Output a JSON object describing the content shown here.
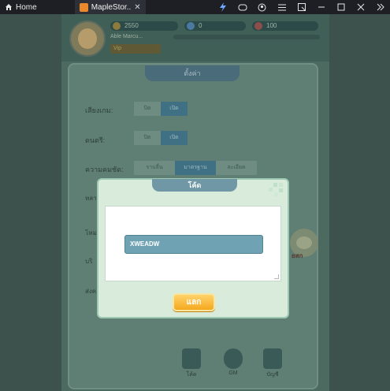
{
  "titlebar": {
    "home_label": "Home",
    "tab_label": "MapleStor...",
    "tab_close": "✕",
    "window_icons": [
      "bolt-icon",
      "gamepad-icon",
      "account-icon",
      "menu-icon",
      "external-icon",
      "minimize-icon",
      "maximize-icon",
      "close-icon",
      "double-chevron-icon"
    ]
  },
  "hud": {
    "gold": "2550",
    "gems": "0",
    "hearts": "100",
    "player_name": "Able Marcu...",
    "vip": "Vip"
  },
  "settings": {
    "title": "ตั้งค่า",
    "rows": [
      {
        "label": "เสียงเกม:",
        "off": "ปิด",
        "on": "เปิด"
      },
      {
        "label": "ดนตรี:",
        "off": "ปิด",
        "on": "เปิด"
      }
    ],
    "clarity": {
      "label": "ความคมชัด:",
      "options": [
        "ราบลื่น",
        "มาตรฐาน",
        "ละเอียด"
      ],
      "selected": "มาตรฐาน"
    },
    "hidden_labels": [
      "หลา",
      "โหม",
      "บริ",
      "ส่งค"
    ],
    "bottom_nav": [
      {
        "label": "โค้ด",
        "icon": "book-icon"
      },
      {
        "label": "GM",
        "icon": "headset-icon"
      },
      {
        "label": "บัญชี",
        "icon": "profile-icon"
      }
    ],
    "mascot_text": "ยสก"
  },
  "dialog": {
    "title": "โค้ด",
    "code_value": "XWEADW",
    "redeem_label": "แลก"
  },
  "colors": {
    "dialog_bg": "#d9ecdb",
    "input_bg": "#6fa3b4",
    "button_gold": "#f5a81f"
  }
}
